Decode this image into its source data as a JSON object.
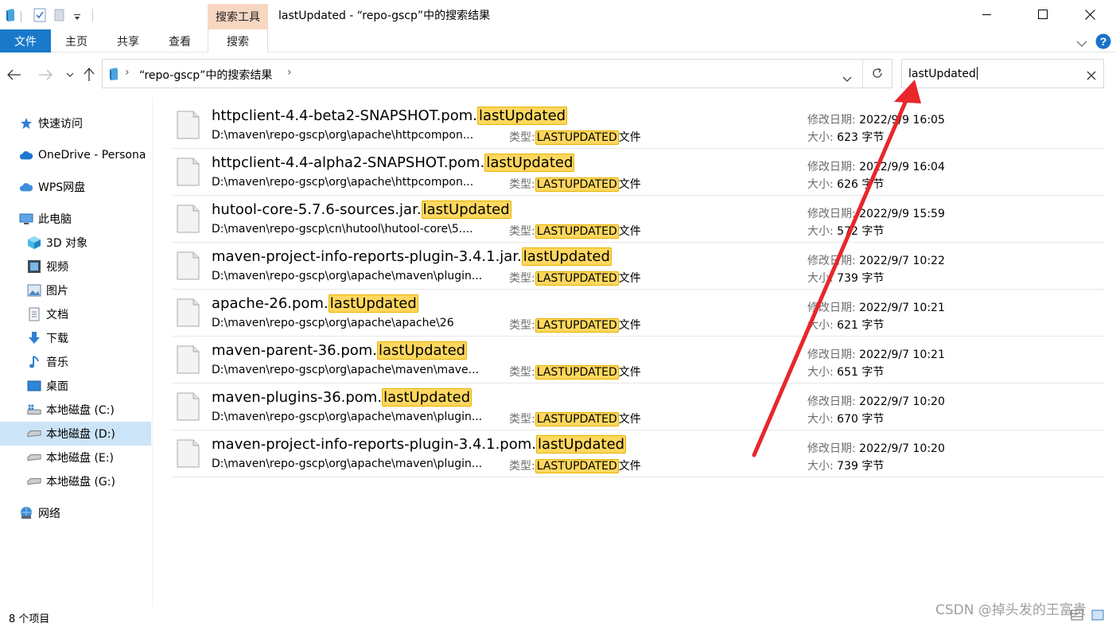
{
  "window": {
    "title": "lastUpdated - “repo-gscp”中的搜索结果",
    "context_tab": "搜索工具"
  },
  "ribbon": {
    "tabs": [
      "文件",
      "主页",
      "共享",
      "查看",
      "搜索"
    ]
  },
  "address": {
    "path": "“repo-gscp”中的搜索结果",
    "chevron": "›"
  },
  "search": {
    "value": "lastUpdated"
  },
  "sidebar": {
    "items": [
      {
        "label": "快速访问",
        "icon": "star-icon"
      },
      {
        "label": "OneDrive - Persona",
        "icon": "cloud-icon"
      },
      {
        "label": "WPS网盘",
        "icon": "wps-cloud-icon"
      },
      {
        "label": "此电脑",
        "icon": "pc-icon"
      },
      {
        "label": "3D 对象",
        "icon": "cube-icon"
      },
      {
        "label": "视频",
        "icon": "video-icon"
      },
      {
        "label": "图片",
        "icon": "picture-icon"
      },
      {
        "label": "文档",
        "icon": "document-icon"
      },
      {
        "label": "下载",
        "icon": "download-icon"
      },
      {
        "label": "音乐",
        "icon": "music-icon"
      },
      {
        "label": "桌面",
        "icon": "desktop-icon"
      },
      {
        "label": "本地磁盘 (C:)",
        "icon": "drive-c-icon"
      },
      {
        "label": "本地磁盘 (D:)",
        "icon": "drive-icon"
      },
      {
        "label": "本地磁盘 (E:)",
        "icon": "drive-icon"
      },
      {
        "label": "本地磁盘 (G:)",
        "icon": "drive-icon"
      },
      {
        "label": "网络",
        "icon": "network-icon"
      }
    ]
  },
  "labels": {
    "type": "类型:",
    "modified": "修改日期:",
    "size": "大小:",
    "type_value": "LASTUPDATED",
    "type_suffix": "文件",
    "highlight": "lastUpdated"
  },
  "files": [
    {
      "base": "httpclient-4.4-beta2-SNAPSHOT.pom.",
      "path": "D:\\maven\\repo-gscp\\org\\apache\\httpcompon...",
      "date": "2022/9/9 16:05",
      "size": "623 字节"
    },
    {
      "base": "httpclient-4.4-alpha2-SNAPSHOT.pom.",
      "path": "D:\\maven\\repo-gscp\\org\\apache\\httpcompon...",
      "date": "2022/9/9 16:04",
      "size": "626 字节"
    },
    {
      "base": "hutool-core-5.7.6-sources.jar.",
      "path": "D:\\maven\\repo-gscp\\cn\\hutool\\hutool-core\\5....",
      "date": "2022/9/9 15:59",
      "size": "572 字节"
    },
    {
      "base": "maven-project-info-reports-plugin-3.4.1.jar.",
      "path": "D:\\maven\\repo-gscp\\org\\apache\\maven\\plugin...",
      "date": "2022/9/7 10:22",
      "size": "739 字节"
    },
    {
      "base": "apache-26.pom.",
      "path": "D:\\maven\\repo-gscp\\org\\apache\\apache\\26",
      "date": "2022/9/7 10:21",
      "size": "621 字节"
    },
    {
      "base": "maven-parent-36.pom.",
      "path": "D:\\maven\\repo-gscp\\org\\apache\\maven\\mave...",
      "date": "2022/9/7 10:21",
      "size": "651 字节"
    },
    {
      "base": "maven-plugins-36.pom.",
      "path": "D:\\maven\\repo-gscp\\org\\apache\\maven\\plugin...",
      "date": "2022/9/7 10:20",
      "size": "670 字节"
    },
    {
      "base": "maven-project-info-reports-plugin-3.4.1.pom.",
      "path": "D:\\maven\\repo-gscp\\org\\apache\\maven\\plugin...",
      "date": "2022/9/7 10:20",
      "size": "739 字节"
    }
  ],
  "status": {
    "count": "8 个项目"
  },
  "watermark": "CSDN @掉头发的王富贵",
  "annotation": {
    "arrow_color": "#e8262b"
  }
}
